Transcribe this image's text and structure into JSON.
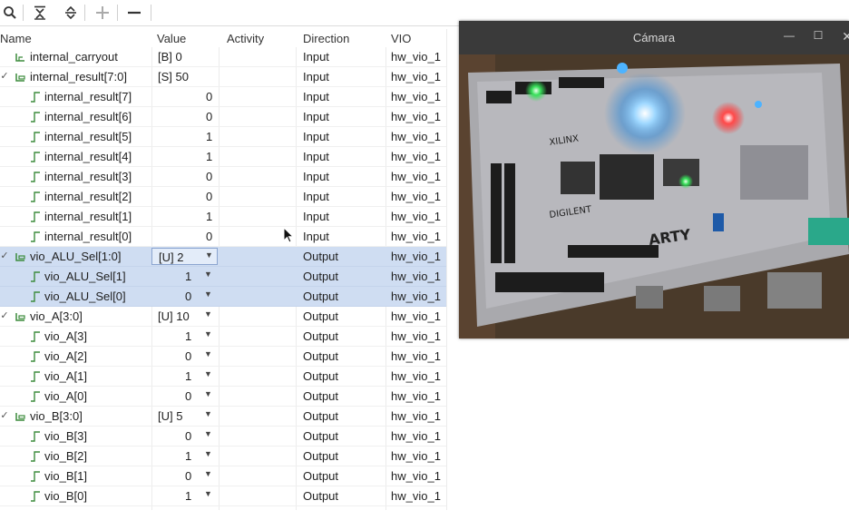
{
  "toolbar": {
    "buttons": [
      "search-icon",
      "collapse-all-icon",
      "expand-all-icon",
      "plus-icon",
      "minus-icon"
    ]
  },
  "header": {
    "name": "Name",
    "value": "Value",
    "activity": "Activity",
    "direction": "Direction",
    "vio": "VIO"
  },
  "rows": [
    {
      "name": "internal_carryout",
      "value": "[B] 0",
      "direction": "Input",
      "vio": "hw_vio_1"
    },
    {
      "name": "internal_result[7:0]",
      "value": "[S] 50",
      "direction": "Input",
      "vio": "hw_vio_1"
    },
    {
      "name": "internal_result[7]",
      "value": "0",
      "direction": "Input",
      "vio": "hw_vio_1"
    },
    {
      "name": "internal_result[6]",
      "value": "0",
      "direction": "Input",
      "vio": "hw_vio_1"
    },
    {
      "name": "internal_result[5]",
      "value": "1",
      "direction": "Input",
      "vio": "hw_vio_1"
    },
    {
      "name": "internal_result[4]",
      "value": "1",
      "direction": "Input",
      "vio": "hw_vio_1"
    },
    {
      "name": "internal_result[3]",
      "value": "0",
      "direction": "Input",
      "vio": "hw_vio_1"
    },
    {
      "name": "internal_result[2]",
      "value": "0",
      "direction": "Input",
      "vio": "hw_vio_1"
    },
    {
      "name": "internal_result[1]",
      "value": "1",
      "direction": "Input",
      "vio": "hw_vio_1"
    },
    {
      "name": "internal_result[0]",
      "value": "0",
      "direction": "Input",
      "vio": "hw_vio_1"
    },
    {
      "name": "vio_ALU_Sel[1:0]",
      "value": "[U] 2",
      "direction": "Output",
      "vio": "hw_vio_1"
    },
    {
      "name": "vio_ALU_Sel[1]",
      "value": "1",
      "direction": "Output",
      "vio": "hw_vio_1"
    },
    {
      "name": "vio_ALU_Sel[0]",
      "value": "0",
      "direction": "Output",
      "vio": "hw_vio_1"
    },
    {
      "name": "vio_A[3:0]",
      "value": "[U] 10",
      "direction": "Output",
      "vio": "hw_vio_1"
    },
    {
      "name": "vio_A[3]",
      "value": "1",
      "direction": "Output",
      "vio": "hw_vio_1"
    },
    {
      "name": "vio_A[2]",
      "value": "0",
      "direction": "Output",
      "vio": "hw_vio_1"
    },
    {
      "name": "vio_A[1]",
      "value": "1",
      "direction": "Output",
      "vio": "hw_vio_1"
    },
    {
      "name": "vio_A[0]",
      "value": "0",
      "direction": "Output",
      "vio": "hw_vio_1"
    },
    {
      "name": "vio_B[3:0]",
      "value": "[U] 5",
      "direction": "Output",
      "vio": "hw_vio_1"
    },
    {
      "name": "vio_B[3]",
      "value": "0",
      "direction": "Output",
      "vio": "hw_vio_1"
    },
    {
      "name": "vio_B[2]",
      "value": "1",
      "direction": "Output",
      "vio": "hw_vio_1"
    },
    {
      "name": "vio_B[1]",
      "value": "0",
      "direction": "Output",
      "vio": "hw_vio_1"
    },
    {
      "name": "vio_B[0]",
      "value": "1",
      "direction": "Output",
      "vio": "hw_vio_1"
    }
  ],
  "camera_window": {
    "title": "Cámara",
    "board_text": {
      "brand": "XILINX",
      "digilent": "DIGILENT",
      "model": "ARTY"
    }
  },
  "colors": {
    "selection": "#cfddf2",
    "accent": "#8aa4cf",
    "window_title_bg": "#3a3a3a"
  }
}
